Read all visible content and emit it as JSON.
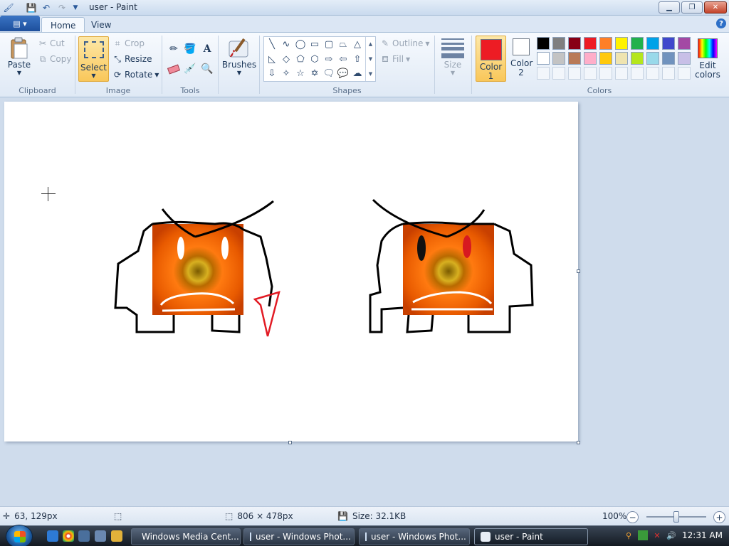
{
  "window": {
    "title": "user - Paint"
  },
  "tabs": {
    "home": "Home",
    "view": "View"
  },
  "clipboard": {
    "paste": "Paste",
    "cut": "Cut",
    "copy": "Copy",
    "group": "Clipboard"
  },
  "image": {
    "select": "Select",
    "crop": "Crop",
    "resize": "Resize",
    "rotate": "Rotate",
    "group": "Image"
  },
  "tools": {
    "group": "Tools"
  },
  "brushes": {
    "label": "Brushes"
  },
  "shapes": {
    "outline": "Outline",
    "fill": "Fill",
    "group": "Shapes"
  },
  "size": {
    "label": "Size"
  },
  "colors": {
    "color1": "Color 1",
    "color2": "Color 2",
    "edit": "Edit colors",
    "group": "Colors",
    "color1_value": "#ed1c24",
    "color2_value": "#ffffff",
    "palette_row1": [
      "#000000",
      "#7f7f7f",
      "#880015",
      "#ed1c24",
      "#ff7f27",
      "#fff200",
      "#22b14c",
      "#00a2e8",
      "#3f48cc",
      "#a349a4"
    ],
    "palette_row2": [
      "#ffffff",
      "#c3c3c3",
      "#b97a57",
      "#ffaec9",
      "#ffc90e",
      "#efe4b0",
      "#b5e61d",
      "#99d9ea",
      "#7092be",
      "#c8bfe7"
    ]
  },
  "status": {
    "cursor": "63, 129px",
    "selection": "",
    "canvas_size": "806 × 478px",
    "file_size": "Size: 32.1KB",
    "zoom": "100%",
    "zoom_level": 1.0
  },
  "taskbar": {
    "tasks": [
      "Windows Media Cent...",
      "user - Windows Phot...",
      "user - Windows Phot...",
      "user - Paint"
    ],
    "clock": "12:31 AM"
  }
}
